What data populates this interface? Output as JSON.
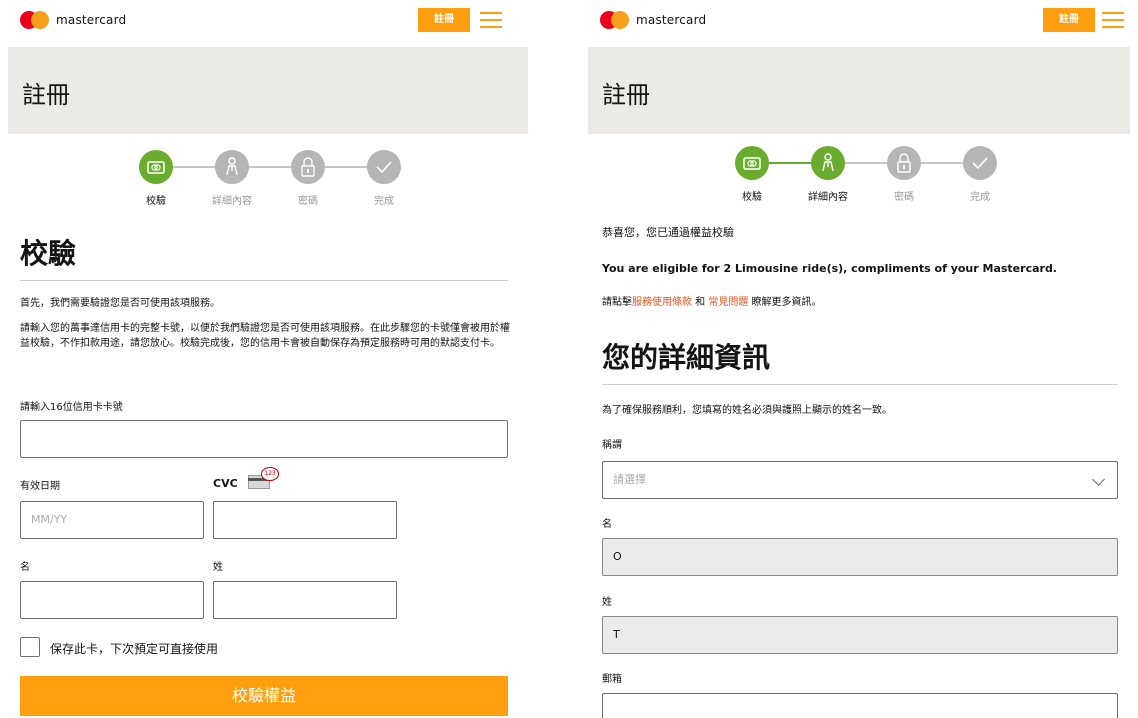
{
  "brand": {
    "name": "mastercard",
    "accent": "#ff9f0f",
    "green": "#6aac2d"
  },
  "header": {
    "register_label": "註冊"
  },
  "page_title": "註冊",
  "steps": [
    "校驗",
    "詳細內容",
    "密碼",
    "完成"
  ],
  "left": {
    "heading": "校驗",
    "intro": "首先，我們需要驗證您是否可使用該項服務。",
    "body": "請輸入您的萬事達信用卡的完整卡號，以便於我們驗證您是否可使用該項服務。在此步驟您的卡號僅會被用於權益校驗，不作扣款用途，請您放心。校驗完成後，您的信用卡會被自動保存為預定服務時可用的默認支付卡。",
    "card_label": "請輸入16位信用卡卡號",
    "expiry_label": "有效日期",
    "expiry_placeholder": "MM/YY",
    "cvc_label": "CVC",
    "cvc_badge": "123",
    "first_name_label": "名",
    "last_name_label": "姓",
    "save_card_label": "保存此卡，下次預定可直接使用",
    "submit_label": "校驗權益"
  },
  "right": {
    "congrats": "恭喜您，您已通過權益校驗",
    "eligible": "You are eligible for 2 Limousine ride(s), compliments of your Mastercard.",
    "info_prefix": "請點擊",
    "info_link_terms": "服務使用條款",
    "info_and": " 和 ",
    "info_link_faq": "常見問題",
    "info_suffix": " 瞭解更多資訊。",
    "heading": "您的詳細資訊",
    "note": "為了確保服務順利，您填寫的姓名必須與護照上顯示的姓名一致。",
    "title_label": "稱謂",
    "title_placeholder": "請選擇",
    "first_name_label": "名",
    "first_name_value": "O",
    "last_name_label": "姓",
    "last_name_value": "T",
    "email_label": "郵箱"
  }
}
